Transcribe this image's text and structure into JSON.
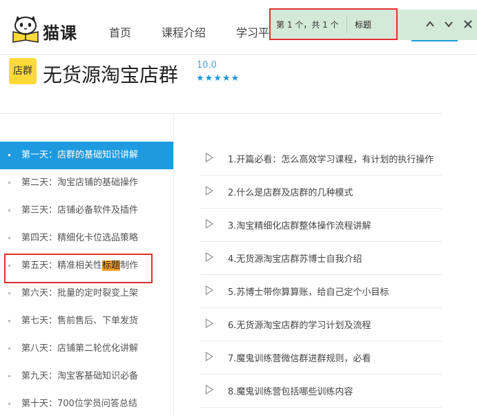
{
  "header": {
    "logo_text": "猫课",
    "nav": [
      "首页",
      "课程介绍",
      "学习平台"
    ]
  },
  "findbar": {
    "count": "第 1 个，共 1 个",
    "query": "标题",
    "up_icon": "chevron-up-icon",
    "down_icon": "chevron-down-icon",
    "close_icon": "close-icon"
  },
  "course": {
    "badge": "店群",
    "title": "无货源淘宝店群",
    "score": "10.0",
    "stars": 5
  },
  "sidebar": {
    "items": [
      {
        "label": "第一天：店群的基础知识讲解",
        "active": true
      },
      {
        "label": "第二天：淘宝店铺的基础操作"
      },
      {
        "label": "第三天：店铺必备软件及插件"
      },
      {
        "label": "第四天：精细化卡位选品策略"
      },
      {
        "label_pre": "第五天：精准相关性",
        "label_hl": "标题",
        "label_post": "制作"
      },
      {
        "label": "第六天：批量的定时裂变上架"
      },
      {
        "label": "第七天：售前售后、下单发货"
      },
      {
        "label": "第八天：店铺第二轮优化讲解"
      },
      {
        "label": "第九天：淘宝客基础知识必备"
      },
      {
        "label": "第十天：700位学员问答总结"
      }
    ]
  },
  "lessons": [
    "1.开篇必看：怎么高效学习课程，有计划的执行操作",
    "2.什么是店群及店群的几种模式",
    "3.淘宝精细化店群整体操作流程讲解",
    "4.无货源淘宝店群苏博士自我介绍",
    "5.苏博士带你算算账，给自己定个小目标",
    "6.无货源淘宝店群的学习计划及流程",
    "7.魔鬼训练营微信群进群规则，必看",
    "8.魔鬼训练营包括哪些训练内容"
  ],
  "colors": {
    "accent": "#1e9be0",
    "findbar_bg": "#d4ead8",
    "badge": "#ffd83a",
    "highlight": "#f39b27",
    "annotation": "#e03030"
  }
}
